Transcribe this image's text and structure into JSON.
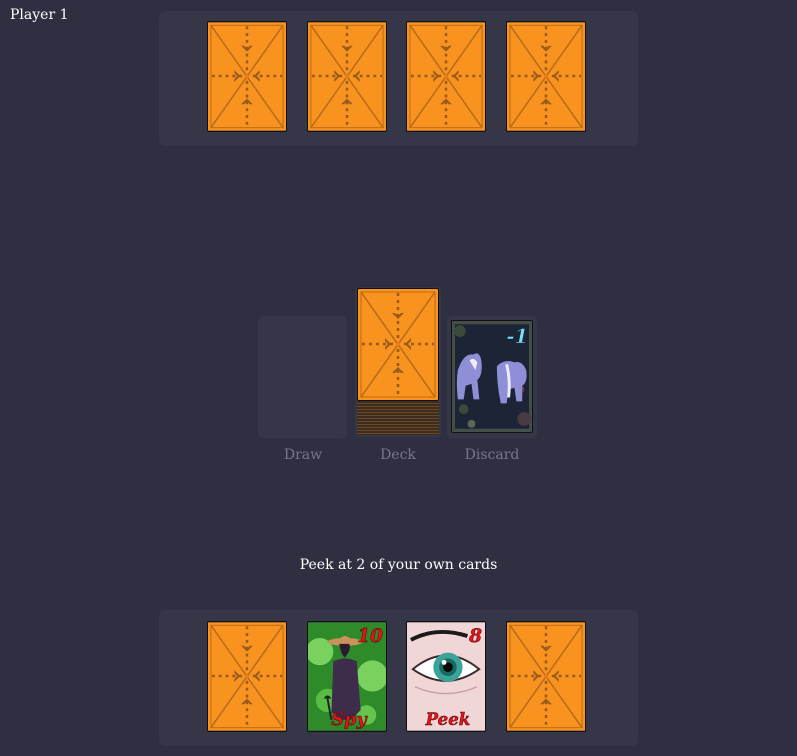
{
  "player": {
    "label": "Player 1"
  },
  "top_hand": {
    "cards": [
      {
        "face": "back"
      },
      {
        "face": "back"
      },
      {
        "face": "back"
      },
      {
        "face": "back"
      }
    ]
  },
  "piles": {
    "draw_label": "Draw",
    "deck_label": "Deck",
    "discard_label": "Discard",
    "discard_card": {
      "value": "-1"
    }
  },
  "prompt": {
    "text": "Peek at 2 of your own cards"
  },
  "bottom_hand": {
    "cards": [
      {
        "face": "back"
      },
      {
        "face": "up",
        "value": "10",
        "name": "Spy"
      },
      {
        "face": "up",
        "value": "8",
        "name": "Peek"
      },
      {
        "face": "back"
      }
    ]
  },
  "colors": {
    "background": "#2f2f42",
    "panel": "#363649",
    "card_back": "#f7931e",
    "card_back_pattern": "#9a5a1c",
    "card_value_red": "#e3141c",
    "discard_value": "#7fdcf0"
  }
}
